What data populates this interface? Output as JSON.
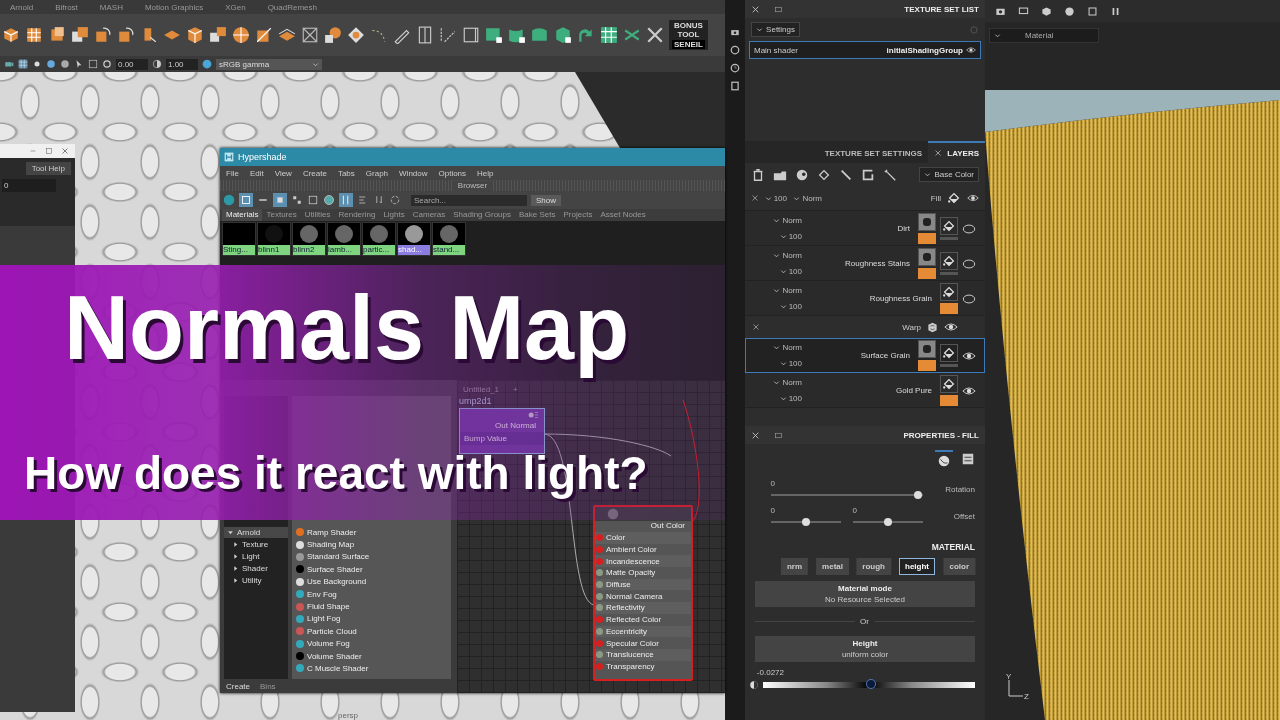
{
  "maya": {
    "shelf_tabs": [
      "Arnold",
      "Bifrost",
      "MASH",
      "Motion Graphics",
      "XGen",
      "QuadRemesh"
    ],
    "bonus_tool": {
      "line1": "BONUS",
      "line2": "TOOL",
      "badge": "SENEIL"
    },
    "viewport_toolbar": {
      "fields": [
        "0.00",
        "1.00"
      ],
      "color_space": "sRGB gamma"
    },
    "side_window": {
      "button": "Tool Help",
      "field": "0"
    },
    "viewport_label": "persp"
  },
  "hypershade": {
    "title": "Hypershade",
    "menu": [
      "File",
      "Edit",
      "View",
      "Create",
      "Tabs",
      "Graph",
      "Window",
      "Options",
      "Help"
    ],
    "browser_label": "Browser",
    "search": {
      "placeholder": "Search..."
    },
    "show_button": "Show",
    "tabs": [
      {
        "label": "Materials",
        "selected": true
      },
      {
        "label": "Textures",
        "selected": false
      },
      {
        "label": "Utilities",
        "selected": false
      },
      {
        "label": "Rendering",
        "selected": false
      },
      {
        "label": "Lights",
        "selected": false
      },
      {
        "label": "Cameras",
        "selected": false
      },
      {
        "label": "Shading Groups",
        "selected": false
      },
      {
        "label": "Bake Sets",
        "selected": false
      },
      {
        "label": "Projects",
        "selected": false
      },
      {
        "label": "Asset Nodes",
        "selected": false
      }
    ],
    "swatches": [
      {
        "label": "Sting...",
        "selected": false
      },
      {
        "label": "blinn1",
        "selected": false
      },
      {
        "label": "blinn2",
        "selected": false
      },
      {
        "label": "lamb...",
        "selected": false
      },
      {
        "label": "partic...",
        "selected": false
      },
      {
        "label": "shad...",
        "selected": true
      },
      {
        "label": "stand...",
        "selected": false
      }
    ],
    "create_tree": [
      {
        "label": "Arnold",
        "expanded": true,
        "children": [
          {
            "label": "Texture"
          },
          {
            "label": "Light"
          },
          {
            "label": "Shader"
          },
          {
            "label": "Utility"
          }
        ]
      }
    ],
    "node_list": [
      "Ramp Shader",
      "Shading Map",
      "Standard Surface",
      "Surface Shader",
      "Use Background",
      "Env Fog",
      "Fluid Shape",
      "Light Fog",
      "Particle Cloud",
      "Volume Fog",
      "Volume Shader",
      "C Muscle Shader"
    ],
    "bottom_tabs": [
      {
        "label": "Create",
        "selected": true
      },
      {
        "label": "Bins",
        "selected": false
      }
    ],
    "graph_tab": "Untitled_1",
    "graph_add": "+",
    "bump_node": {
      "title": "ump2d1",
      "output": "Out Normal",
      "input": "Bump Value"
    },
    "blinn_node": {
      "output": "Out Color",
      "attributes": [
        {
          "label": "Color",
          "color": "#d81e1e"
        },
        {
          "label": "Ambient Color",
          "color": "#d81e1e"
        },
        {
          "label": "Incandescence",
          "color": "#d81e1e"
        },
        {
          "label": "Matte Opacity",
          "color": "#8c9a84"
        },
        {
          "label": "Diffuse",
          "color": "#8c9a84"
        },
        {
          "label": "Normal Camera",
          "color": "#8c9a84"
        },
        {
          "label": "Reflectivity",
          "color": "#8c9a84"
        },
        {
          "label": "Reflected Color",
          "color": "#d81e1e"
        },
        {
          "label": "Eccentricity",
          "color": "#8c9a84"
        },
        {
          "label": "Specular Color",
          "color": "#d81e1e"
        },
        {
          "label": "Translucence",
          "color": "#8c9a84"
        },
        {
          "label": "Transparency",
          "color": "#d81e1e"
        }
      ]
    }
  },
  "banner": {
    "title": "Normals Map",
    "subtitle": "How does it react with light?"
  },
  "texture_set_list": {
    "title": "TEXTURE SET LIST",
    "settings": "Settings",
    "set": {
      "shader": "Main shader",
      "name": "initialShadingGroup",
      "selected": true
    }
  },
  "layers": {
    "tabs": [
      {
        "label": "TEXTURE SET SETTINGS",
        "selected": false
      },
      {
        "label": "LAYERS",
        "selected": true
      }
    ],
    "channel": "Base Color",
    "fill": {
      "name": "Fill",
      "blend": "Norm",
      "opacity": "100"
    },
    "items": [
      {
        "kind": "fill",
        "name": "Dirt",
        "blend": "Norm",
        "opacity": "100",
        "visible": false,
        "mask": true,
        "selected": false
      },
      {
        "kind": "fill",
        "name": "Roughness Stains",
        "blend": "Norm",
        "opacity": "100",
        "visible": false,
        "mask": true,
        "selected": false
      },
      {
        "kind": "fill",
        "name": "Roughness Grain",
        "blend": "Norm",
        "opacity": "100",
        "visible": false,
        "mask": false,
        "selected": false
      },
      {
        "kind": "effect",
        "name": "Warp",
        "visible": true,
        "selected": false
      },
      {
        "kind": "fill",
        "name": "Surface Grain",
        "blend": "Norm",
        "opacity": "100",
        "visible": true,
        "mask": true,
        "selected": true
      },
      {
        "kind": "fill",
        "name": "Gold Pure",
        "blend": "Norm",
        "opacity": "100",
        "visible": true,
        "mask": false,
        "selected": false
      }
    ]
  },
  "properties": {
    "title": "PROPERTIES - FILL",
    "rotation": {
      "label": "Rotation",
      "value": "0",
      "level": 0.97
    },
    "offset": {
      "label": "Offset",
      "values": [
        {
          "value": "0",
          "level": 0.5
        },
        {
          "value": "0",
          "level": 0.5
        }
      ]
    },
    "material_heading": "MATERIAL",
    "channels": [
      {
        "label": "nrm",
        "selected": false
      },
      {
        "label": "metal",
        "selected": false
      },
      {
        "label": "rough",
        "selected": false
      },
      {
        "label": "height",
        "selected": true
      },
      {
        "label": "color",
        "selected": false
      }
    ],
    "material_mode": {
      "title": "Material mode",
      "subtitle": "No Resource Selected"
    },
    "or": "Or",
    "height": {
      "title": "Height",
      "subtitle": "uniform color",
      "value": "-0.0272",
      "level": 0.51
    }
  },
  "viewport": {
    "mode": "Material",
    "axes": [
      "Y",
      "Z"
    ]
  }
}
